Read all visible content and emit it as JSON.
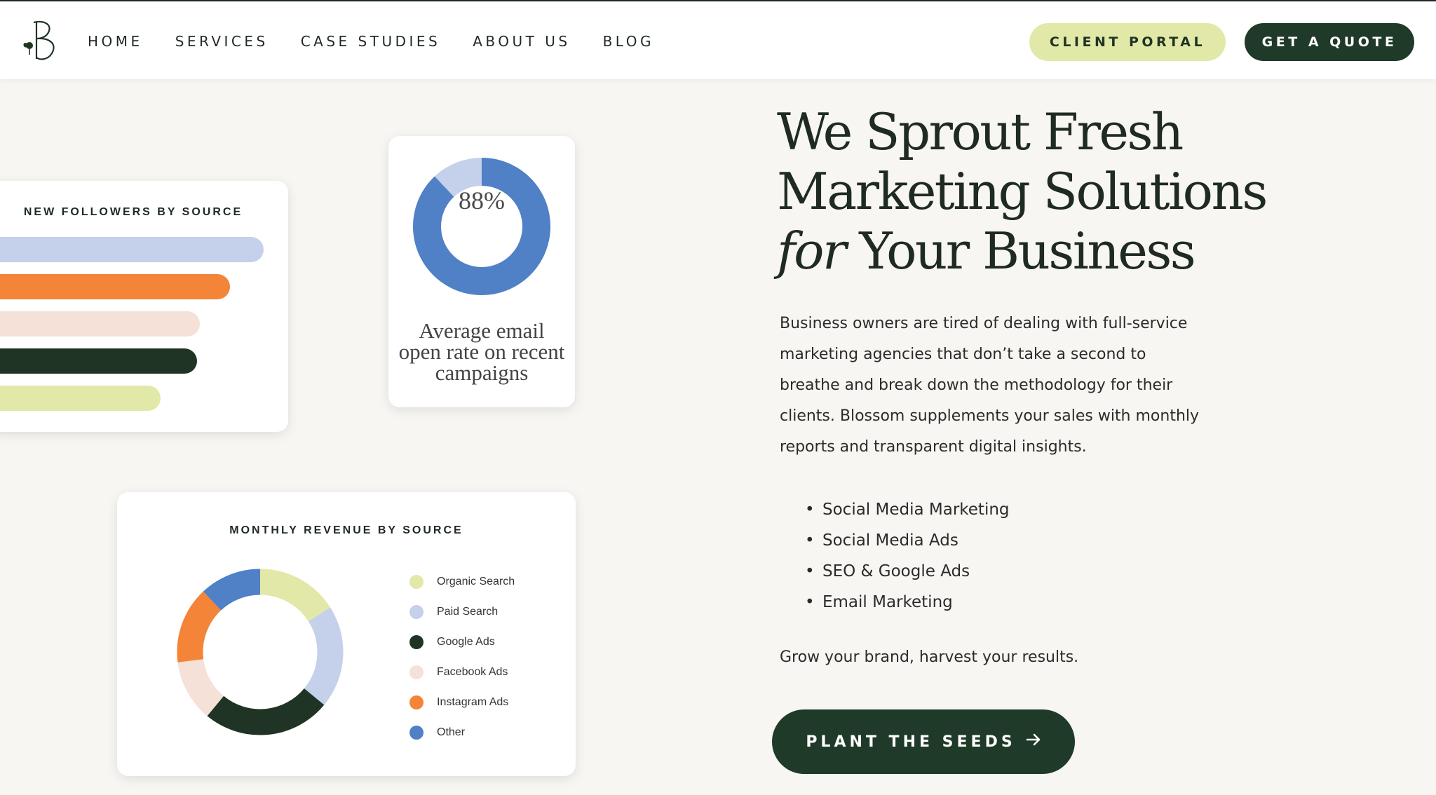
{
  "nav": {
    "logo_icon": "blossom-b-logo",
    "links": [
      "HOME",
      "SERVICES",
      "CASE STUDIES",
      "ABOUT US",
      "BLOG"
    ],
    "client_portal": "CLIENT PORTAL",
    "get_quote": "GET A QUOTE"
  },
  "followers_card": {
    "title": "NEW FOLLOWERS BY SOURCE",
    "bars": [
      {
        "color": "#c5d0ea",
        "value": 100
      },
      {
        "color": "#f38438",
        "value": 88
      },
      {
        "color": "#f5e1d8",
        "value": 77
      },
      {
        "color": "#1f3424",
        "value": 76
      },
      {
        "color": "#e2e8a7",
        "value": 63
      }
    ]
  },
  "email_card": {
    "percent_label": "88%",
    "percent": 88,
    "caption": "Average email open rate on recent campaigns",
    "fill_color": "#5080c5",
    "track_color": "#c5d0ea"
  },
  "revenue_card": {
    "title": "MONTHLY REVENUE BY SOURCE",
    "legend": [
      {
        "label": "Organic Search",
        "color": "#e2e8a7"
      },
      {
        "label": "Paid Search",
        "color": "#c5d0ea"
      },
      {
        "label": "Google Ads",
        "color": "#1f3424"
      },
      {
        "label": "Facebook Ads",
        "color": "#f5e1d8"
      },
      {
        "label": "Instagram Ads",
        "color": "#f38438"
      },
      {
        "label": "Other",
        "color": "#5080c5"
      }
    ]
  },
  "chart_data": [
    {
      "type": "bar",
      "title": "NEW FOLLOWERS BY SOURCE",
      "orientation": "horizontal",
      "values": [
        100,
        88,
        77,
        76,
        63
      ],
      "colors": [
        "#c5d0ea",
        "#f38438",
        "#f5e1d8",
        "#1f3424",
        "#e2e8a7"
      ]
    },
    {
      "type": "pie",
      "title": "MONTHLY REVENUE BY SOURCE",
      "categories": [
        "Organic Search",
        "Paid Search",
        "Google Ads",
        "Facebook Ads",
        "Instagram Ads",
        "Other"
      ],
      "values": [
        16,
        20,
        25,
        12,
        15,
        12
      ],
      "colors": [
        "#e2e8a7",
        "#c5d0ea",
        "#1f3424",
        "#f5e1d8",
        "#f38438",
        "#5080c5"
      ]
    }
  ],
  "hero": {
    "title_line1": "We Sprout Fresh",
    "title_line2": "Marketing Solutions",
    "title_italic": "for",
    "title_line3_rest": " Your Business",
    "description": "Business owners are tired of dealing with full-service marketing agencies that don’t take a second to breathe and break down the methodology for their clients. Blossom supplements your sales with monthly reports and transparent digital insights.",
    "services": [
      "Social Media Marketing",
      "Social Media Ads",
      "SEO & Google Ads",
      "Email Marketing"
    ],
    "tagline": "Grow your brand, harvest your results.",
    "cta": "PLANT THE SEEDS",
    "cta_icon": "arrow-right-icon"
  }
}
